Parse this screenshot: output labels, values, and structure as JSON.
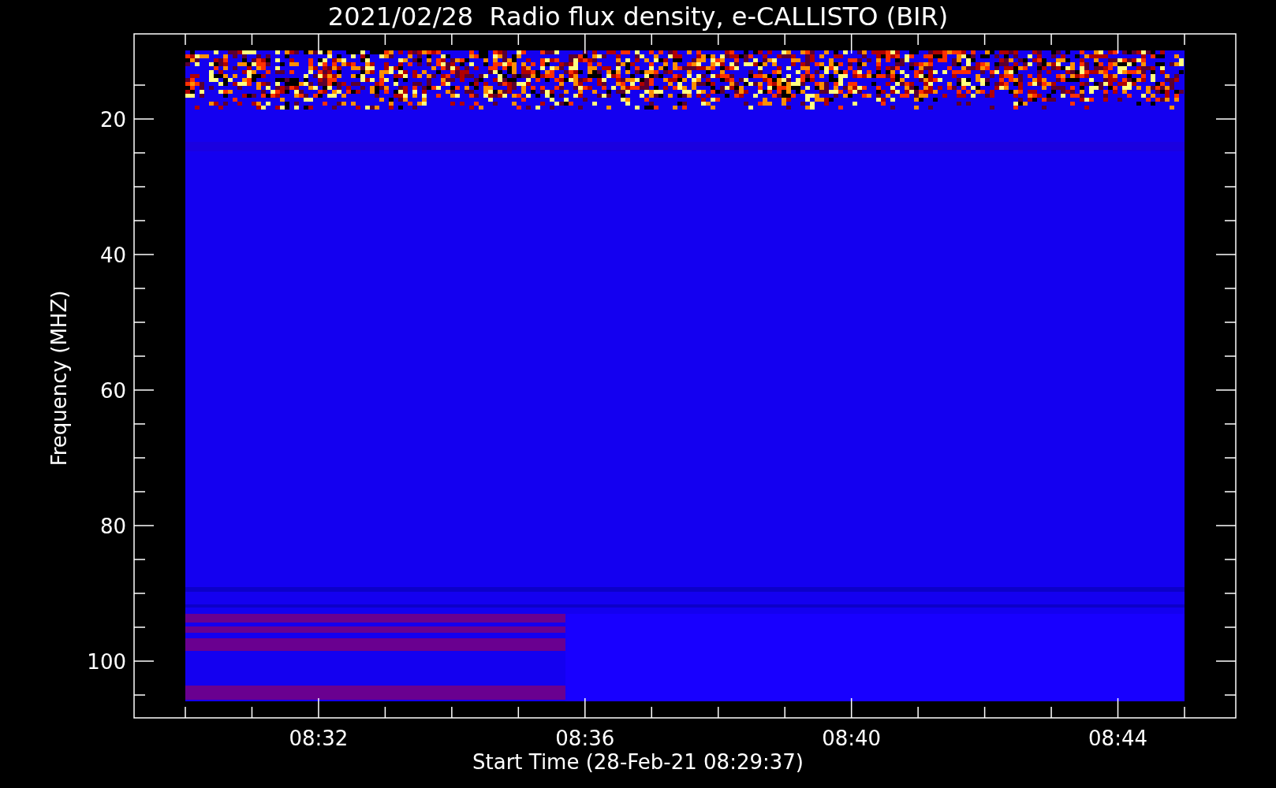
{
  "title": "2021/02/28  Radio flux density, e-CALLISTO (BIR)",
  "ylabel": "Frequency (MHZ)",
  "xlabel": "Start Time (28-Feb-21 08:29:37)",
  "yticks": [
    "20",
    "40",
    "60",
    "80",
    "100"
  ],
  "xticks": [
    "08:32",
    "08:36",
    "08:40",
    "08:44"
  ]
}
